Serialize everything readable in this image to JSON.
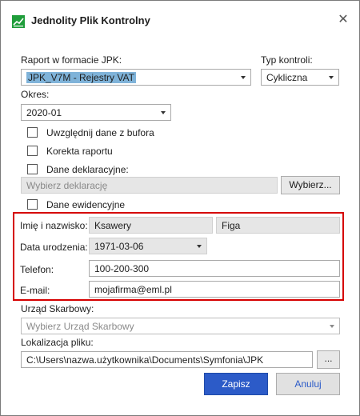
{
  "window": {
    "title": "Jednolity Plik Kontrolny",
    "close_glyph": "✕"
  },
  "report": {
    "label": "Raport w formacie JPK:",
    "selected": "JPK_V7M - Rejestry VAT"
  },
  "control": {
    "label": "Typ kontroli:",
    "selected": "Cykliczna"
  },
  "period": {
    "label": "Okres:",
    "selected": "2020-01"
  },
  "options": {
    "buffer_label": "Uwzględnij dane z bufora",
    "correction_label": "Korekta raportu",
    "declaration_label": "Dane deklaracyjne:",
    "declaration_placeholder": "Wybierz deklarację",
    "choose_button": "Wybierz...",
    "records_label": "Dane ewidencyjne"
  },
  "person": {
    "name_label": "Imię i nazwisko:",
    "first_name": "Ksawery",
    "last_name": "Figa",
    "dob_label": "Data urodzenia:",
    "dob": "1971-03-06",
    "phone_label": "Telefon:",
    "phone": "100-200-300",
    "email_label": "E-mail:",
    "email": "mojafirma@eml.pl"
  },
  "tax_office": {
    "label": "Urząd Skarbowy:",
    "placeholder": "Wybierz Urząd Skarbowy"
  },
  "file_location": {
    "label": "Lokalizacja pliku:",
    "path": "C:\\Users\\nazwa.użytkownika\\Documents\\Symfonia\\JPK",
    "browse_button": "..."
  },
  "buttons": {
    "save": "Zapisz",
    "cancel": "Anuluj"
  },
  "colors": {
    "accent": "#2c5bc8",
    "highlight_box": "#d50000",
    "selection": "#7fb3d9"
  }
}
